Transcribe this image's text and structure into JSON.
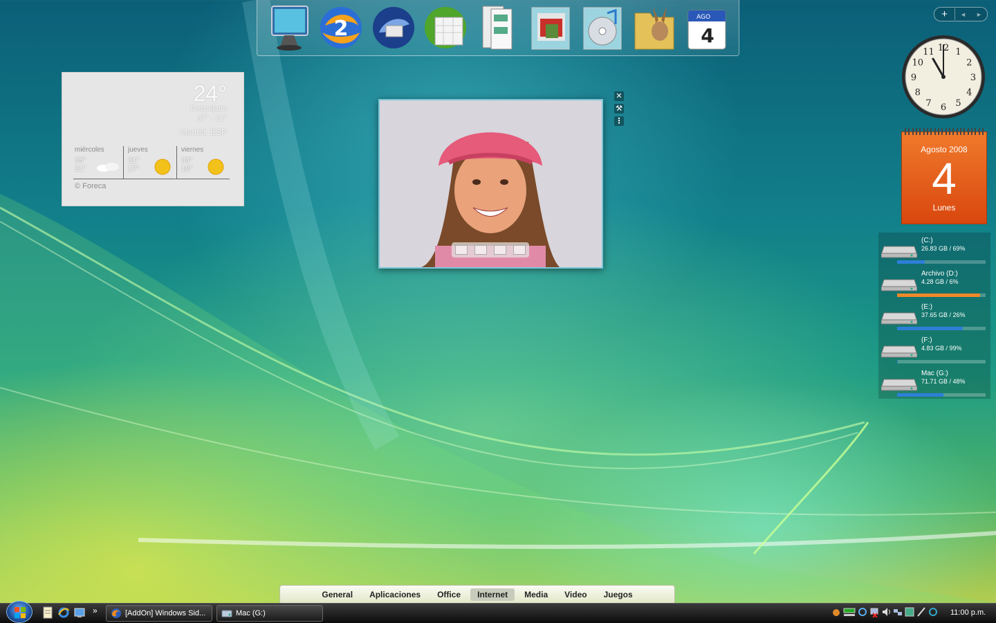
{
  "dock": {
    "icons": [
      "monitor-icon",
      "browser-icon",
      "thunderbird-icon",
      "calendar-app-icon",
      "documents-icon",
      "pictures-icon",
      "music-icon",
      "emule-folder-icon",
      "ical-icon"
    ],
    "ical_month": "AGO",
    "ical_day": "4"
  },
  "weather": {
    "temp": "24°",
    "condition": "Despejado",
    "range": "37° - 21°",
    "location": "Madrid, ESP",
    "days": [
      {
        "name": "miércoles",
        "hi": "35°",
        "lo": "21°",
        "icon": "cloudy-icon"
      },
      {
        "name": "jueves",
        "hi": "31°",
        "lo": "17°",
        "icon": "sun-icon"
      },
      {
        "name": "viernes",
        "hi": "33°",
        "lo": "18°",
        "icon": "sun-icon"
      }
    ],
    "credit": "© Foreca"
  },
  "clock": {
    "hour": 11,
    "minute": 0,
    "numbers": [
      "12",
      "1",
      "2",
      "3",
      "4",
      "5",
      "6",
      "7",
      "8",
      "9",
      "10",
      "11"
    ]
  },
  "calendar": {
    "month_year": "Agosto 2008",
    "day": "4",
    "weekday": "Lunes"
  },
  "drives": [
    {
      "name": "(C:)",
      "info": "26.83 GB / 69%",
      "fill": 0.31,
      "color": "#2e7fd8"
    },
    {
      "name": "Archivo (D:)",
      "info": "4.28 GB / 6%",
      "fill": 0.94,
      "color": "#f0892a"
    },
    {
      "name": "(E:)",
      "info": "37.65 GB / 26%",
      "fill": 0.74,
      "color": "#2e7fd8"
    },
    {
      "name": "(F:)",
      "info": "4.83 GB / 99%",
      "fill": 0.01,
      "color": "#2e7fd8"
    },
    {
      "name": "Mac (G:)",
      "info": "71.71 GB / 48%",
      "fill": 0.52,
      "color": "#2e7fd8"
    }
  ],
  "categories": [
    "General",
    "Aplicaciones",
    "Office",
    "Internet",
    "Media",
    "Video",
    "Juegos"
  ],
  "active_category": "Internet",
  "taskbar": {
    "quick_launch": [
      "notepad-icon",
      "ie-icon",
      "show-desktop-icon"
    ],
    "chevron": "»",
    "windows": [
      {
        "label": "[AddOn] Windows Sid...",
        "icon": "firefox-icon"
      },
      {
        "label": "Mac (G:)",
        "icon": "explorer-icon"
      }
    ],
    "tray_icons": [
      "tray-app-icon",
      "network-meter-icon",
      "sync-icon",
      "network-error-icon",
      "volume-icon",
      "network-icon",
      "device-icon",
      "pen-icon",
      "refresh-icon"
    ],
    "time": "11:00 p.m."
  },
  "sidebar": {
    "add": "+",
    "prev": "◄",
    "next": "►"
  }
}
